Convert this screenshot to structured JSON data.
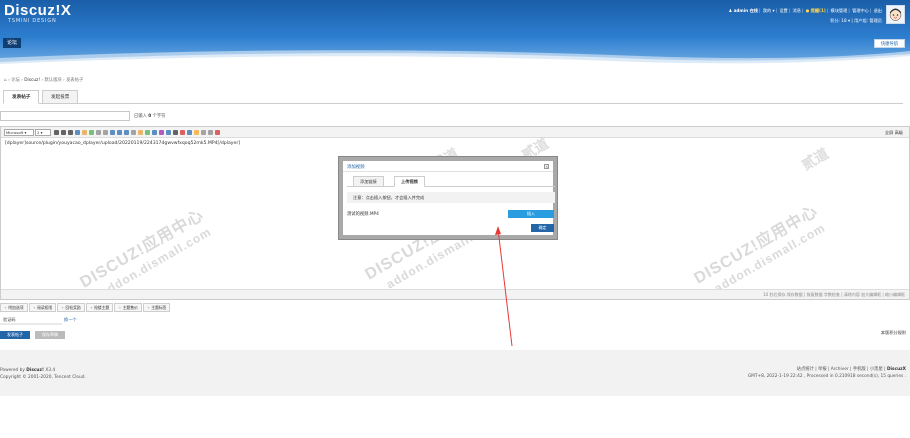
{
  "header": {
    "logo_main": "Discuz!X",
    "logo_sub": "TSMINI DESIGN",
    "topbar_links": [
      "admin 在线",
      "我的 ▾",
      "设置",
      "消息",
      "提醒(1)",
      "模块管理",
      "管理中心",
      "退出"
    ],
    "topbar2": "积分: 18 ▾  |  用户组: 管理员",
    "nav_tag": "论坛",
    "quick_nav": "快捷导航"
  },
  "breadcrumb": [
    "论坛",
    "Discuz!",
    "默认版块",
    "发表帖子"
  ],
  "tabs": [
    "发表帖子",
    "发起投票"
  ],
  "title_hint": {
    "prefix": "已输入",
    "count": "0",
    "suffix": "个字符"
  },
  "editor": {
    "font_select": "Microsoft",
    "size_select": "2",
    "right_links": "全屏  高级",
    "content": "[dplayer]source/plugin/youyacao_dplayer/upload/20220119/224317dgwvwfxqoq52mk5.MP4[/dplayer]",
    "status": "10 秒后保存  保存数据  |  恢复数据    字数检查  |  清除内容    加大编辑框  |  缩小编辑框",
    "toolbar_colors": [
      "#333333",
      "#333333",
      "#333333",
      "#2a6bb3",
      "#e6a23c",
      "#4caf50",
      "#888888",
      "#888888",
      "#2a6bb3",
      "#2a6bb3",
      "#2a6bb3",
      "#888888",
      "#e6a23c",
      "#4caf50",
      "#2a6bb3",
      "#9c27b0",
      "#2a6bb3",
      "#333333",
      "#d32f2f",
      "#2a6bb3",
      "#f5a623",
      "#888888",
      "#888888",
      "#d32f2f"
    ]
  },
  "dialog": {
    "title": "添加视频",
    "close": "×",
    "tabs": [
      "添加链接",
      "上传视频"
    ],
    "note": "注意：点击插入按钮，才会插入并完成",
    "file_name": "测试的视频.MP4",
    "insert_button": "插入",
    "ok_button": "确定"
  },
  "bottom_tabs": [
    "附加选项",
    "阅读权限",
    "回帖奖励",
    "抢楼主题",
    "主题售价",
    "主题标签"
  ],
  "verify": {
    "label": "验证码",
    "link": "换一个"
  },
  "buttons": {
    "publish": "发表帖子",
    "draft": "保存草稿"
  },
  "rules_link": "本版积分规则",
  "footer": {
    "powered_prefix": "Powered by",
    "powered_name": "Discuz!",
    "version": "X3.4",
    "copyright": "Copyright © 2001-2020, Tencent Cloud.",
    "right_links": "站点统计  |  举报  |  Archiver  |  手机版  |  小黑屋  |",
    "right_brand": "DiscuzX",
    "right_time": "GMT+8, 2022-1-19 22:42 , Processed in 0.210918 second(s), 15 queries ."
  },
  "watermark": {
    "line1": "DISCUZ!应用中心",
    "line2": "addon.dismall.com",
    "mark": "贰道"
  },
  "colors": {
    "header_blue": "#2d7ed0",
    "accent": "#2366a8",
    "insert_btn": "#2a9ce0",
    "arrow": "#e53935"
  }
}
